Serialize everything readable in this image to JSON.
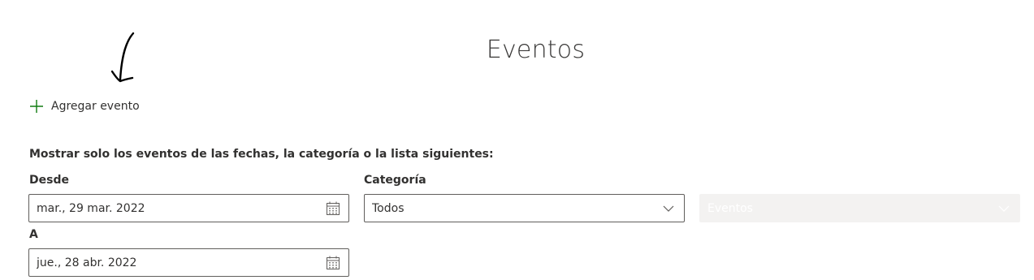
{
  "header": {
    "title": "Eventos"
  },
  "actions": {
    "add_event_label": "Agregar evento"
  },
  "filters": {
    "intro": "Mostrar solo los eventos de las fechas, la categoría o la lista siguientes:",
    "from": {
      "label": "Desde",
      "value": "mar., 29 mar. 2022",
      "icon": "calendar-icon"
    },
    "to": {
      "label": "A",
      "value": "jue., 28 abr. 2022",
      "icon": "calendar-icon"
    },
    "category": {
      "label": "Categoría",
      "selected": "Todos",
      "icon": "chevron-down-icon"
    },
    "list": {
      "selected": "Eventos",
      "disabled": true,
      "icon": "chevron-down-icon"
    }
  },
  "colors": {
    "accent_plus": "#107c10",
    "border": "#605e5c",
    "disabled_bg": "#f3f2f1",
    "text": "#323130"
  }
}
